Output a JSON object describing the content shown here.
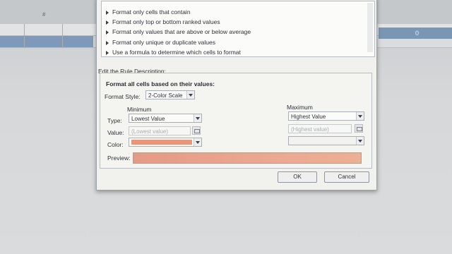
{
  "background": {
    "column_headers": [
      " ",
      "#",
      " "
    ],
    "cell_value": "0"
  },
  "dialog": {
    "rule_types": [
      "Format only cells that contain",
      "Format only top or bottom ranked values",
      "Format only values that are above or below average",
      "Format only unique or duplicate values",
      "Use a formula to determine which cells to format"
    ],
    "edit_label": "Edit the Rule Description:",
    "desc_title": "Format all cells based on their values:",
    "format_style_label": "Format Style:",
    "format_style_value": "2-Color Scale",
    "minimum_label": "Minimum",
    "maximum_label": "Maximum",
    "type_label": "Type:",
    "value_label": "Value:",
    "color_label": "Color:",
    "min_type": "Lowest Value",
    "max_type": "Highest Value",
    "min_value": "(Lowest value)",
    "max_value": "(Highest value)",
    "min_color": "#e8957d",
    "preview_label": "Preview:",
    "ok_label": "OK",
    "cancel_label": "Cancel"
  }
}
